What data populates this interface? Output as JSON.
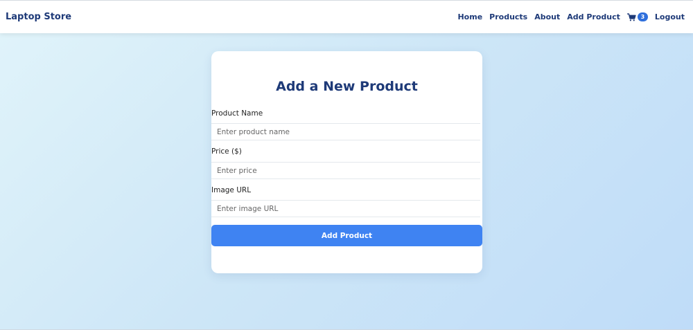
{
  "nav": {
    "brand": "Laptop Store",
    "links": {
      "home": "Home",
      "products": "Products",
      "about": "About",
      "add_product": "Add Product",
      "logout": "Logout"
    },
    "cart_icon": "cart-icon",
    "cart_count": "3"
  },
  "form": {
    "title": "Add a New Product",
    "fields": {
      "name": {
        "label": "Product Name",
        "placeholder": "Enter product name"
      },
      "price": {
        "label": "Price ($)",
        "placeholder": "Enter price"
      },
      "image": {
        "label": "Image URL",
        "placeholder": "Enter image URL"
      }
    },
    "submit_label": "Add Product"
  },
  "colors": {
    "brand": "#1e3a78",
    "button": "#3f83f2",
    "badge": "#2f6fdc"
  }
}
